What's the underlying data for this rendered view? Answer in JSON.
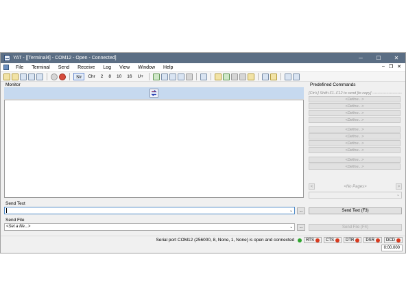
{
  "window": {
    "title": "YAT - [[Terminal4] - COM12 - Open - Connected]",
    "minimize_glyph": "─",
    "maximize_glyph": "☐",
    "close_glyph": "✕"
  },
  "menu": {
    "items": [
      "File",
      "Terminal",
      "Send",
      "Receive",
      "Log",
      "View",
      "Window",
      "Help"
    ],
    "mdi_minimize": "–",
    "mdi_restore": "❐",
    "mdi_close": "✕"
  },
  "toolbar": {
    "radix_buttons": [
      "Str",
      "Chr",
      "2",
      "8",
      "10",
      "16",
      "U+"
    ],
    "active_radix": "Str"
  },
  "monitor": {
    "label": "Monitor"
  },
  "predefined": {
    "label": "Predefined Commands",
    "hint": "[Ctrl+] Shift+F1..F12 to send [to copy]",
    "define_label": "<Define...>",
    "pager_text": "<No Pages>",
    "prev_glyph": "<",
    "next_glyph": ">"
  },
  "send_text": {
    "label": "Send Text",
    "value": "",
    "browse_label": "...",
    "button_label": "Send Text (F3)"
  },
  "send_file": {
    "label": "Send File",
    "value": "<Set a file...>",
    "browse_label": "...",
    "button_label": "Send File (F4)"
  },
  "status": {
    "text": "Serial port COM12 (256000, 8, None, 1, None) is open and connected",
    "signals": [
      {
        "name": "RTS",
        "color": "#d83a1f"
      },
      {
        "name": "CTS",
        "color": "#d83a1f"
      },
      {
        "name": "DTR",
        "color": "#d83a1f"
      },
      {
        "name": "DSR",
        "color": "#d83a1f"
      },
      {
        "name": "DCD",
        "color": "#d83a1f"
      }
    ],
    "open_indicator_color": "#2fa52f",
    "timer": "0:00.000"
  },
  "colors": {
    "titlebar": "#5b6e84",
    "monitor_header": "#c6d9ef",
    "focus_border": "#4d89c7"
  }
}
